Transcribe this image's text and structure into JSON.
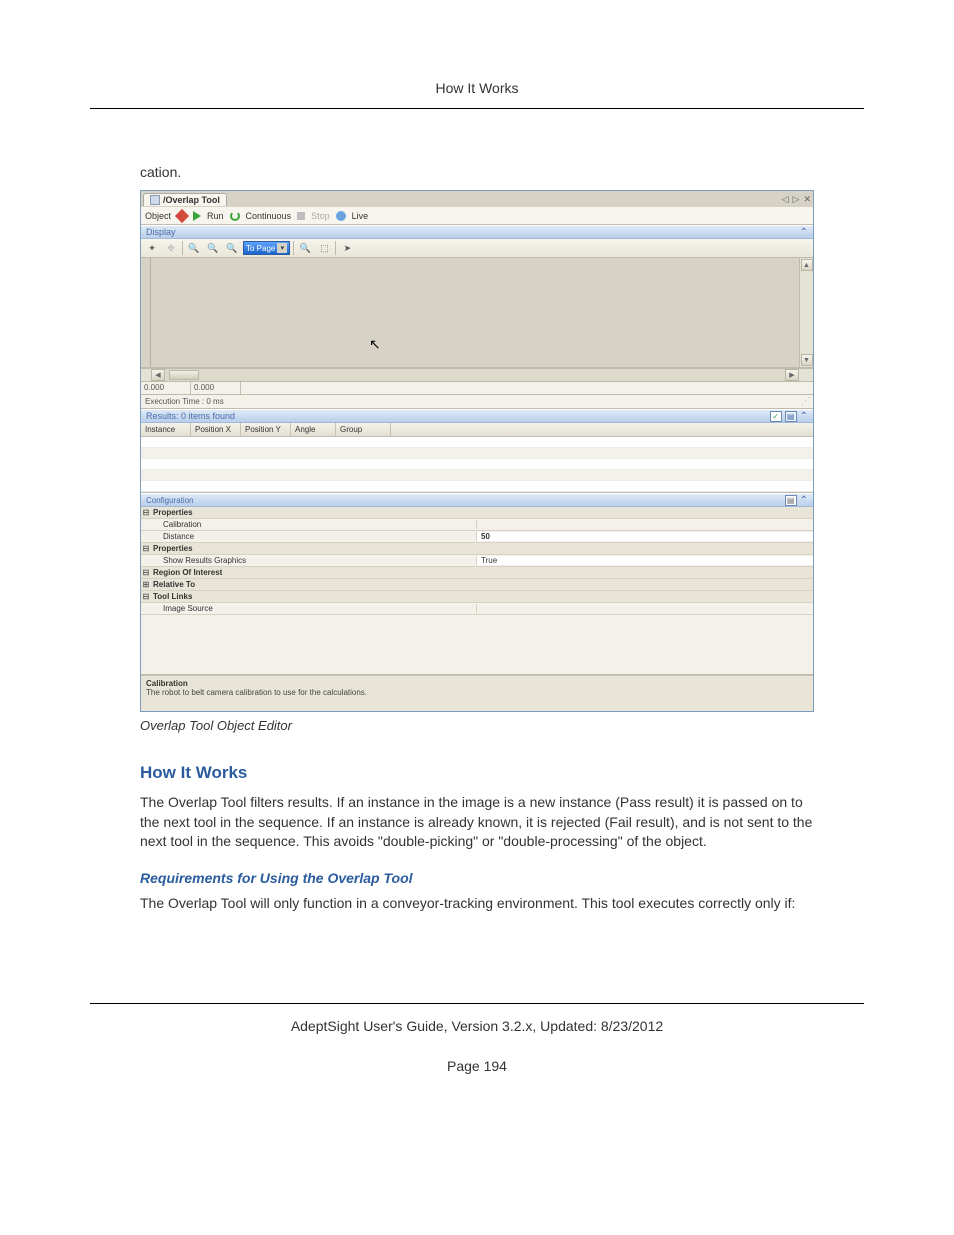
{
  "page": {
    "header_title": "How It Works",
    "fragment_text": "cation.",
    "caption": "Overlap Tool Object Editor",
    "section_heading": "How It Works",
    "paragraph1": "The Overlap Tool filters results. If an instance in the image is a new instance (Pass result) it is passed on to the next tool in the sequence. If an instance is already known, it is rejected (Fail result), and is not sent to the next tool in the sequence. This avoids \"double-picking\" or \"double-processing\" of the object.",
    "sub_heading": "Requirements for Using the Overlap Tool",
    "paragraph2": "The Overlap Tool will only function in a conveyor-tracking environment. This tool executes correctly only if:",
    "footer_guide": "AdeptSight User's Guide,  Version 3.2.x, Updated: 8/23/2012",
    "footer_page": "Page 194"
  },
  "app": {
    "tab_title": "/Overlap Tool",
    "nav_prev": "◁",
    "nav_next": "▷",
    "nav_close": "✕",
    "toolbar1": {
      "object_label": "Object",
      "run_label": "Run",
      "continuous_label": "Continuous",
      "stop_label": "Stop",
      "live_label": "Live"
    },
    "display_section": "Display",
    "section_collapse": "⌃",
    "zoom_select": "To Page",
    "zoom_dd": "▾",
    "coords": {
      "x": "0.000",
      "y": "0.000"
    },
    "exec_time": "Execution Time : 0 ms",
    "results": {
      "title": "Results: 0 items found",
      "columns": [
        "Instance",
        "Position X",
        "Position Y",
        "Angle",
        "Group"
      ]
    },
    "config": {
      "title": "Configuration",
      "rows": [
        {
          "type": "section",
          "exp": "⊟",
          "key": "Properties"
        },
        {
          "type": "prop",
          "key": "Calibration",
          "val": ""
        },
        {
          "type": "prop",
          "key": "Distance",
          "val": "50"
        },
        {
          "type": "section",
          "exp": "⊟",
          "key": "Properties"
        },
        {
          "type": "prop",
          "key": "Show Results Graphics",
          "val": "True"
        },
        {
          "type": "section",
          "exp": "⊟",
          "key": "Region Of Interest"
        },
        {
          "type": "section",
          "exp": "⊞",
          "key": "Relative To"
        },
        {
          "type": "section",
          "exp": "⊟",
          "key": "Tool Links"
        },
        {
          "type": "prop",
          "key": "Image Source",
          "val": ""
        }
      ],
      "footer_title": "Calibration",
      "footer_desc": "The robot to belt camera calibration to use for the calculations."
    },
    "scroll": {
      "left": "◀",
      "right": "▶",
      "up": "▲",
      "down": "▼"
    }
  }
}
